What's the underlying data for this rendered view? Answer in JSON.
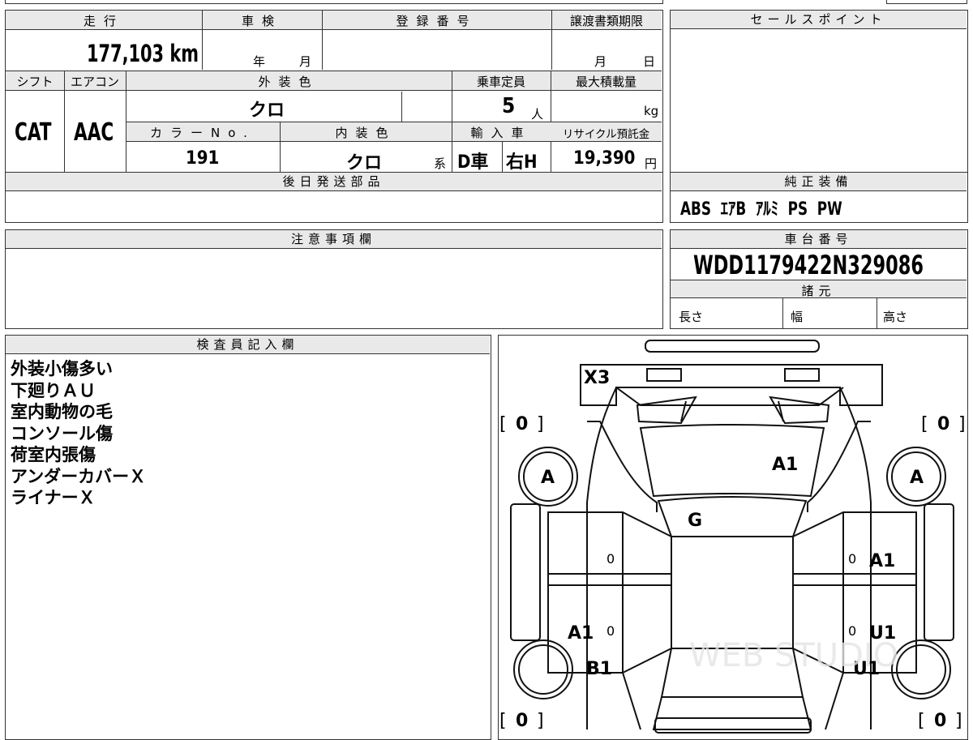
{
  "top_table": {
    "h_mileage": "走行",
    "h_inspection": "車検",
    "h_registration": "登録番号",
    "h_transfer_deadline": "譲渡書類期限",
    "mileage": "177,103 km",
    "insp_year": "年",
    "insp_month": "月",
    "transfer_month": "月",
    "transfer_day": "日",
    "h_shift": "シフト",
    "h_aircon": "エアコン",
    "h_exterior": "外装色",
    "h_capacity": "乗車定員",
    "h_max_load": "最大積載量",
    "shift": "CAT",
    "aircon": "AAC",
    "exterior_color": "クロ",
    "capacity": "5",
    "capacity_unit": "人",
    "load_unit": "kg",
    "h_color_no": "カラーNo.",
    "h_interior": "内装色",
    "h_import": "輸入車",
    "h_recycle": "リサイクル預託金",
    "color_no": "191",
    "interior_color": "クロ",
    "interior_suffix": "系",
    "import_type": "D車",
    "handle": "右H",
    "recycle_fee": "19,390",
    "recycle_unit": "円",
    "h_later_parts": "後日発送部品",
    "h_notes": "注意事項欄"
  },
  "right_panel": {
    "h_sales_point": "セールスポイント",
    "h_genuine_equipment": "純正装備",
    "equipment": "ABS  ｴｱB  ｱﾙﾐ  PS  PW",
    "h_chassis_no": "車台番号",
    "chassis_no": "WDD1179422N329086",
    "h_specs": "諸元",
    "length_label": "長さ",
    "width_label": "幅",
    "height_label": "高さ"
  },
  "inspector": {
    "header": "検査員記入欄",
    "remarks": [
      "外装小傷多い",
      "下廻りＡＵ",
      "室内動物の毛",
      "コンソール傷",
      "荷室内張傷",
      "アンダーカバーＸ",
      "ライナーＸ"
    ]
  },
  "diagram": {
    "marks": {
      "front_bumper": "X3",
      "hood": "A1",
      "windshield": "G",
      "front_left_tire": "A",
      "front_right_tire": "A",
      "right_front_door": "A1",
      "left_rear_door": "A1",
      "right_rear_door": "U1",
      "left_rear_fender": "B1",
      "right_rear_fender": "U1",
      "zero_fl": "0",
      "zero_fr": "0",
      "zero_rl": "0",
      "zero_rr": "0",
      "door_l1": "0",
      "door_r1": "0",
      "door_l2": "0",
      "door_r2": "0"
    },
    "watermark": "WEB STUDIO",
    "bracket_left": "[",
    "bracket_right": "]"
  }
}
